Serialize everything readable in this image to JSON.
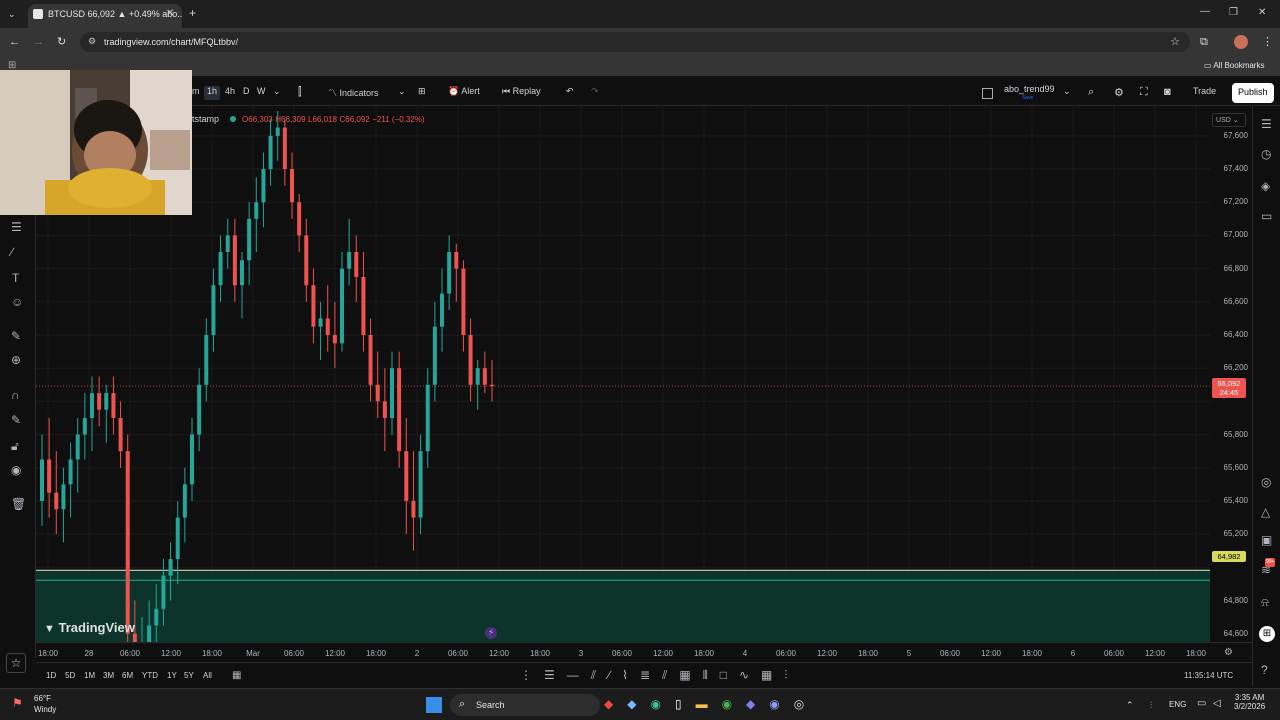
{
  "browser": {
    "tab_title": "BTCUSD 66,092 ▲ +0.49% abo...",
    "url": "tradingview.com/chart/MFQLtbbv/",
    "all_bookmarks": "All Bookmarks"
  },
  "toolbar": {
    "intervals": [
      "m",
      "1h",
      "4h",
      "D",
      "W"
    ],
    "active_interval": "1h",
    "indicators_label": "Indicators",
    "alert_label": "Alert",
    "replay_label": "Replay",
    "layout_name": "abo_trend99",
    "layout_sub": "Save",
    "trade_label": "Trade",
    "publish_label": "Publish"
  },
  "legend": {
    "symbol_suffix": "tstamp",
    "open": "O66,303",
    "high": "H66,309",
    "low": "L66,018",
    "close": "C66,092",
    "change": "−211 (−0.32%)"
  },
  "price_axis": {
    "currency": "USD",
    "labels": [
      "67,600",
      "67,400",
      "67,200",
      "67,000",
      "66,800",
      "66,600",
      "66,400",
      "66,200",
      "65,800",
      "65,600",
      "65,400",
      "65,200",
      "64,800",
      "64,600"
    ],
    "current_price": "66,092",
    "countdown": "24:45",
    "level_price": "64,982"
  },
  "time_axis": {
    "labels": [
      "18:00",
      "28",
      "06:00",
      "12:00",
      "18:00",
      "Mar",
      "06:00",
      "12:00",
      "18:00",
      "2",
      "06:00",
      "12:00",
      "18:00",
      "3",
      "06:00",
      "12:00",
      "18:00",
      "4",
      "06:00",
      "12:00",
      "18:00",
      "5",
      "06:00",
      "12:00",
      "18:00",
      "6",
      "06:00",
      "12:00",
      "18:00"
    ]
  },
  "bottom": {
    "ranges": [
      "1D",
      "5D",
      "1M",
      "3M",
      "6M",
      "YTD",
      "1Y",
      "5Y",
      "All"
    ],
    "clock": "11:35:14 UTC"
  },
  "watermark": "TradingView",
  "taskbar": {
    "weather_temp": "66°F",
    "weather_desc": "Windy",
    "search_label": "Search",
    "lang": "ENG",
    "time": "3:35 AM",
    "date": "3/2/2026",
    "badge_count": "99+"
  },
  "colors": {
    "up": "#26a69a",
    "down": "#ef5350",
    "zone": "#0d3b30",
    "level_line": "#e8e8c8"
  },
  "chart_data": {
    "type": "candlestick",
    "symbol": "BTCUSD",
    "interval": "1h",
    "ylim": [
      64550,
      67780
    ],
    "current_price": 66092,
    "horizontal_level": 64982,
    "zone": [
      64450,
      64982
    ],
    "candles_ohlc": [
      [
        65400,
        65800,
        65250,
        65650
      ],
      [
        65650,
        65900,
        65300,
        65450
      ],
      [
        65450,
        65700,
        65200,
        65350
      ],
      [
        65350,
        65600,
        65150,
        65500
      ],
      [
        65500,
        65750,
        65300,
        65650
      ],
      [
        65650,
        65900,
        65450,
        65800
      ],
      [
        65800,
        66050,
        65650,
        65900
      ],
      [
        65900,
        66150,
        65700,
        66050
      ],
      [
        66050,
        66150,
        65850,
        65950
      ],
      [
        65950,
        66100,
        65750,
        66050
      ],
      [
        66050,
        66150,
        65800,
        65900
      ],
      [
        65900,
        66000,
        65600,
        65700
      ],
      [
        65700,
        65800,
        64500,
        64600
      ],
      [
        64600,
        64800,
        64350,
        64450
      ],
      [
        64450,
        64700,
        64300,
        64550
      ],
      [
        64550,
        64800,
        64400,
        64650
      ],
      [
        64650,
        64900,
        64500,
        64750
      ],
      [
        64750,
        65050,
        64650,
        64950
      ],
      [
        64950,
        65150,
        64800,
        65050
      ],
      [
        65050,
        65400,
        64900,
        65300
      ],
      [
        65300,
        65600,
        65150,
        65500
      ],
      [
        65500,
        65900,
        65400,
        65800
      ],
      [
        65800,
        66200,
        65700,
        66100
      ],
      [
        66100,
        66500,
        66000,
        66400
      ],
      [
        66400,
        66800,
        66300,
        66700
      ],
      [
        66700,
        67000,
        66600,
        66900
      ],
      [
        66900,
        67100,
        66800,
        67000
      ],
      [
        67000,
        67100,
        66600,
        66700
      ],
      [
        66700,
        66900,
        66500,
        66850
      ],
      [
        66850,
        67200,
        66700,
        67100
      ],
      [
        67100,
        67350,
        66900,
        67200
      ],
      [
        67200,
        67500,
        67050,
        67400
      ],
      [
        67400,
        67700,
        67300,
        67600
      ],
      [
        67600,
        67750,
        67450,
        67650
      ],
      [
        67650,
        67700,
        67300,
        67400
      ],
      [
        67400,
        67500,
        67100,
        67200
      ],
      [
        67200,
        67250,
        66900,
        67000
      ],
      [
        67000,
        67100,
        66600,
        66700
      ],
      [
        66700,
        66800,
        66350,
        66450
      ],
      [
        66450,
        66600,
        66250,
        66500
      ],
      [
        66500,
        66700,
        66300,
        66400
      ],
      [
        66400,
        66600,
        66200,
        66350
      ],
      [
        66350,
        66900,
        66300,
        66800
      ],
      [
        66800,
        67100,
        66700,
        66900
      ],
      [
        66900,
        67000,
        66600,
        66750
      ],
      [
        66750,
        66900,
        66300,
        66400
      ],
      [
        66400,
        66500,
        66000,
        66100
      ],
      [
        66100,
        66300,
        65900,
        66000
      ],
      [
        66000,
        66200,
        65700,
        65900
      ],
      [
        65900,
        66300,
        65800,
        66200
      ],
      [
        66200,
        66300,
        65600,
        65700
      ],
      [
        65700,
        65900,
        65200,
        65400
      ],
      [
        65400,
        65700,
        65100,
        65300
      ],
      [
        65300,
        65800,
        65200,
        65700
      ],
      [
        65700,
        66200,
        65600,
        66100
      ],
      [
        66100,
        66600,
        66000,
        66450
      ],
      [
        66450,
        66800,
        66300,
        66650
      ],
      [
        66650,
        67000,
        66550,
        66900
      ],
      [
        66900,
        66950,
        66600,
        66800
      ],
      [
        66800,
        66850,
        66300,
        66400
      ],
      [
        66400,
        66500,
        66000,
        66100
      ],
      [
        66100,
        66250,
        65950,
        66200
      ],
      [
        66200,
        66300,
        66050,
        66100
      ],
      [
        66100,
        66250,
        66000,
        66092
      ]
    ]
  }
}
